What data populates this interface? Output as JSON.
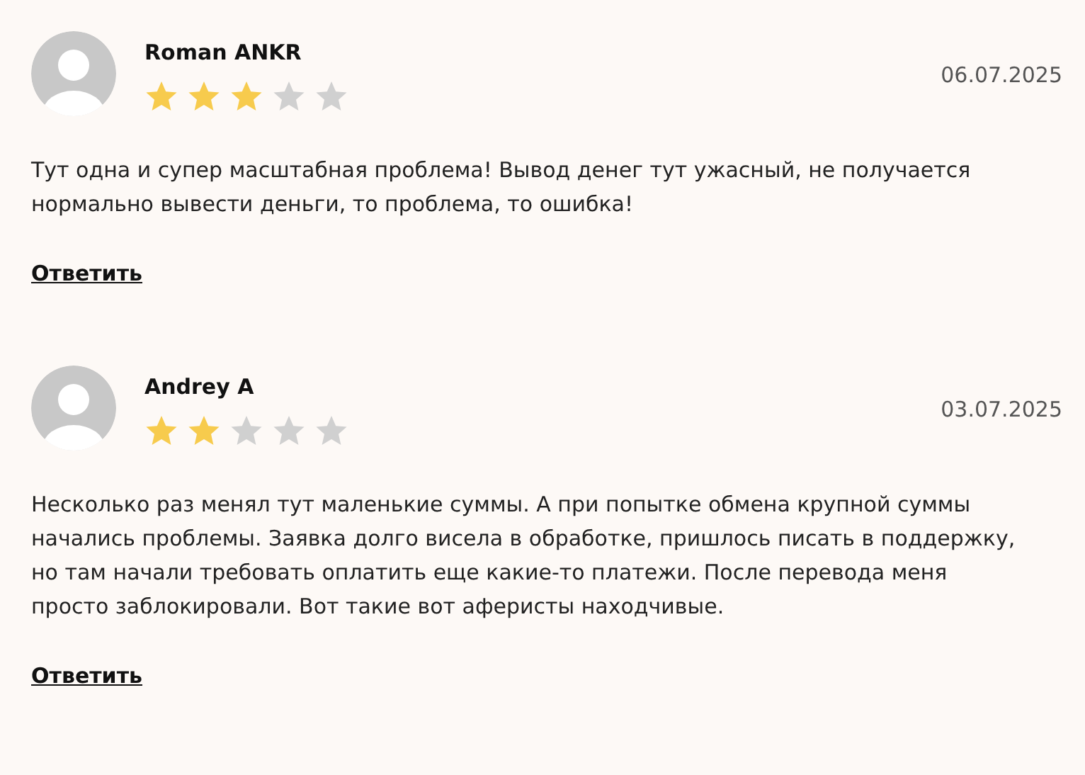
{
  "reviews": [
    {
      "author": "Roman ANKR",
      "stars": 3,
      "date": "06.07.2025",
      "text": "Тут одна и супер масштабная проблема! Вывод денег тут ужасный, не получается нормально вывести деньги, то проблема, то ошибка!",
      "reply": "Ответить"
    },
    {
      "author": "Andrey A",
      "stars": 2,
      "date": "03.07.2025",
      "text": "Несколько раз менял тут маленькие суммы. А при попытке обмена крупной суммы начались проблемы. Заявка долго висела в обработке, пришлось писать в поддержку, но там начали требовать оплатить еще какие-то платежи. После перевода меня просто заблокировали. Вот такие вот аферисты находчивые.",
      "reply": "Ответить"
    }
  ]
}
